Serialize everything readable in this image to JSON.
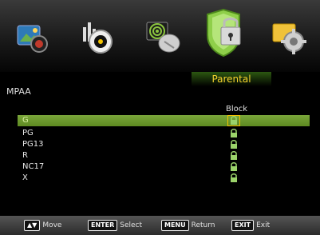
{
  "tabs": [
    {
      "name": "picture",
      "icon": "picture-icon",
      "active": false
    },
    {
      "name": "sound",
      "icon": "speaker-icon",
      "active": false
    },
    {
      "name": "channel",
      "icon": "satellite-dish-icon",
      "active": false
    },
    {
      "name": "parental",
      "icon": "shield-lock-icon",
      "active": true,
      "label": "Parental"
    },
    {
      "name": "setup",
      "icon": "gear-icon",
      "active": false
    }
  ],
  "section_title": "MPAA",
  "column_header": "Block",
  "rows": [
    {
      "label": "G",
      "selected": true,
      "icon": "lock-icon"
    },
    {
      "label": "PG",
      "selected": false,
      "icon": "lock-icon"
    },
    {
      "label": "PG13",
      "selected": false,
      "icon": "lock-icon"
    },
    {
      "label": "R",
      "selected": false,
      "icon": "lock-icon"
    },
    {
      "label": "NC17",
      "selected": false,
      "icon": "lock-icon"
    },
    {
      "label": "X",
      "selected": false,
      "icon": "lock-icon"
    }
  ],
  "footer": {
    "move": {
      "key_icon": "up-down-arrows-icon",
      "text": "Move"
    },
    "select": {
      "key": "ENTER",
      "text": "Select"
    },
    "return": {
      "key": "MENU",
      "text": "Return"
    },
    "exit": {
      "key": "EXIT",
      "text": "Exit"
    }
  },
  "colors": {
    "accent_green": "#6f9a2e",
    "caption_yellow": "#f5d22e",
    "lock_green": "#9bd36a"
  }
}
